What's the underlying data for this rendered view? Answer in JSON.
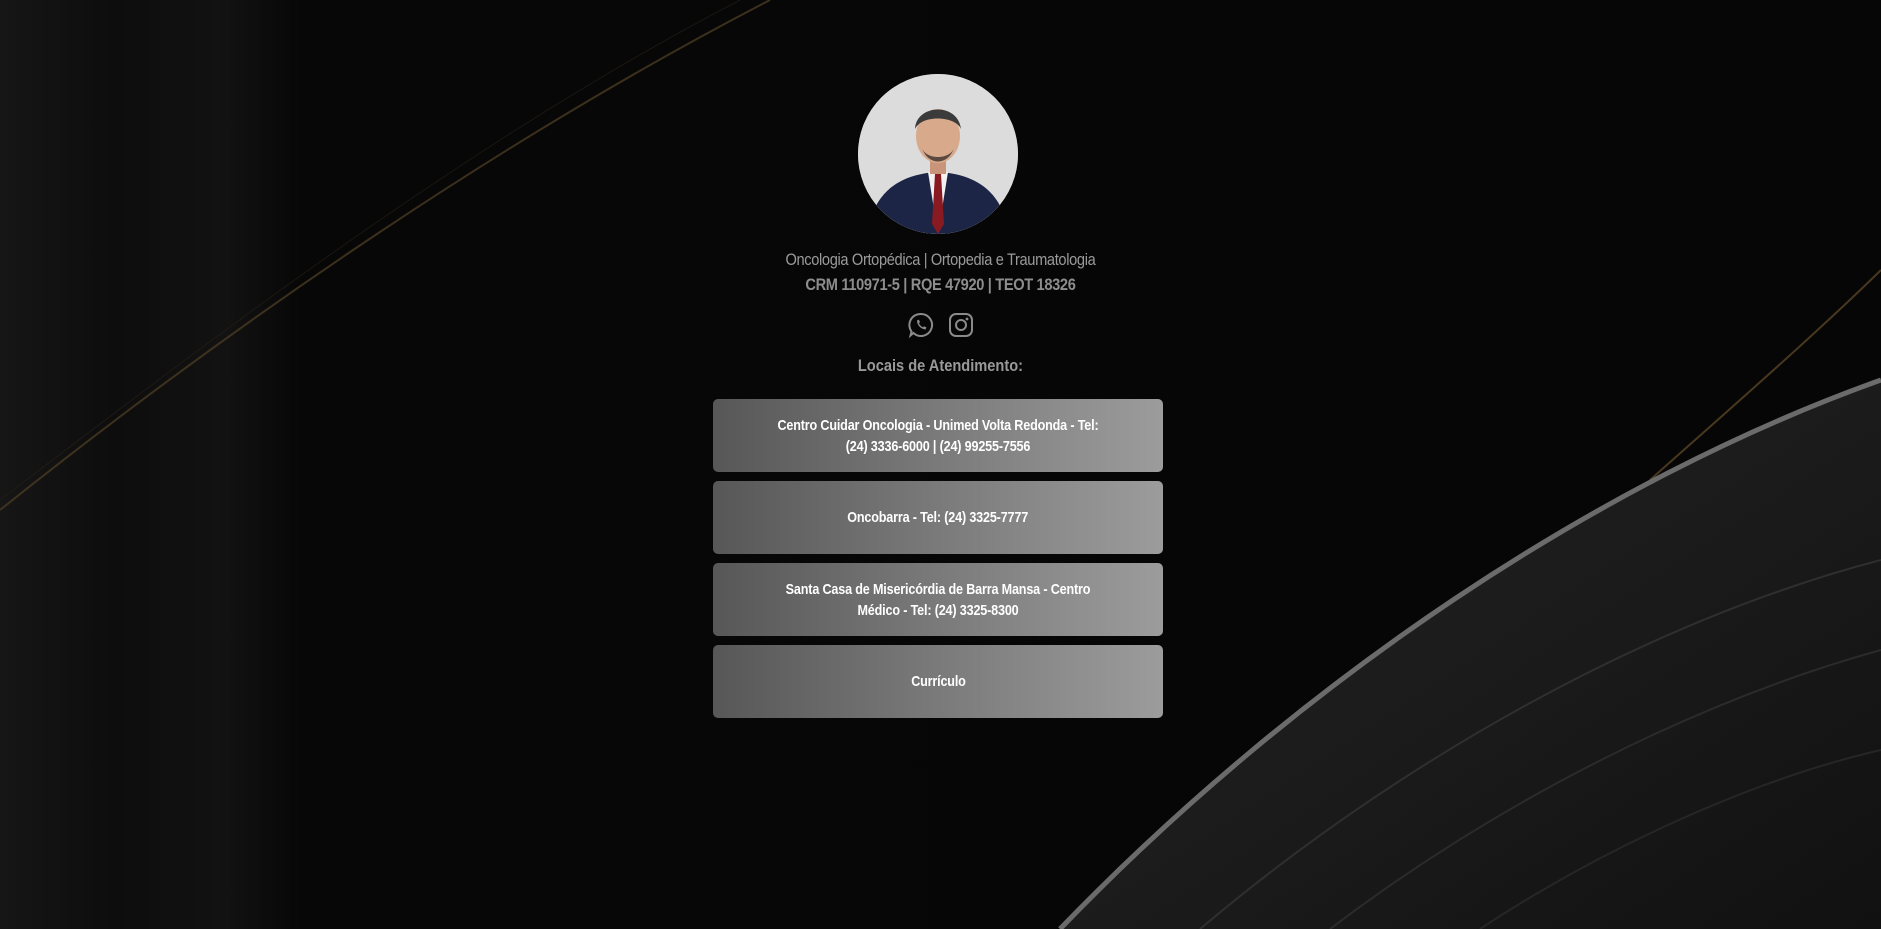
{
  "profile": {
    "specialty": "Oncologia Ortopédica | Ortopedia e Traumatologia",
    "registrations": "CRM 110971-5 | RQE 47920 | TEOT 18326"
  },
  "socials": [
    {
      "name": "whatsapp-icon"
    },
    {
      "name": "instagram-icon"
    }
  ],
  "section_title": "Locais de Atendimento:",
  "links": [
    {
      "label": "Centro Cuidar Oncologia - Unimed Volta Redonda - Tel: (24) 3336-6000 | (24) 99255-7556"
    },
    {
      "label": "Oncobarra - Tel: (24) 3325-7777"
    },
    {
      "label": "Santa Casa de Misericórdia de Barra Mansa - Centro Médico - Tel: (24) 3325-8300"
    },
    {
      "label": "Currículo"
    }
  ],
  "colors": {
    "background": "#070707",
    "button_gradient_start": "#575757",
    "button_gradient_end": "#9c9c9c",
    "text_muted": "#9a9a9a",
    "icon": "#8a8a8a"
  }
}
